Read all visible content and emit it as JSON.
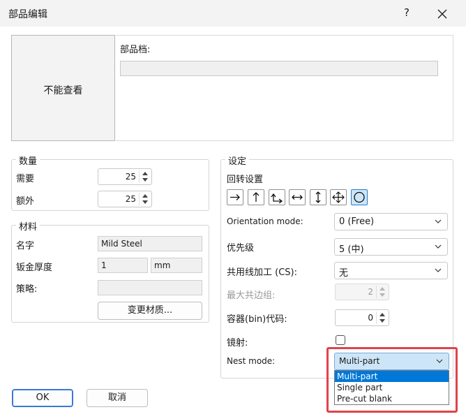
{
  "window": {
    "title": "部品编辑",
    "help": "?"
  },
  "preview": {
    "text": "不能查看"
  },
  "partfile": {
    "label": "部品档:",
    "value": ""
  },
  "quantity": {
    "legend": "数量",
    "required_label": "需要",
    "required_value": "25",
    "extra_label": "额外",
    "extra_value": "25"
  },
  "material": {
    "legend": "材料",
    "name_label": "名字",
    "name_value": "Mild Steel",
    "thickness_label": "钣金厚度",
    "thickness_value": "1",
    "thickness_unit": "mm",
    "strategy_label": "策略:",
    "strategy_value": "",
    "change_button": "变更材质..."
  },
  "settings": {
    "legend": "设定",
    "rotation_label": "回转设置",
    "rotation_icons": [
      "arrow-right-icon",
      "arrow-up-icon",
      "arrow-corner-icon",
      "arrow-left-right-icon",
      "arrow-up-down-icon",
      "move-cross-icon",
      "circle-free-icon"
    ],
    "orientation_label": "Orientation mode:",
    "orientation_value": "0 (Free)",
    "priority_label": "优先级",
    "priority_value": "5 (中)",
    "common_cut_label": "共用线加工 (CS):",
    "common_cut_value": "无",
    "max_common_label": "最大共边组:",
    "max_common_value": "2",
    "bin_code_label": "容器(bin)代码:",
    "bin_code_value": "0",
    "mirror_label": "镜射:",
    "nest_mode_label": "Nest mode:",
    "nest_mode_value": "Multi-part",
    "nest_mode_options": [
      "Multi-part",
      "Single part",
      "Pre-cut blank"
    ]
  },
  "buttons": {
    "ok": "OK",
    "cancel": "取消"
  },
  "colors": {
    "accent": "#0078d7",
    "highlight": "#e0434a",
    "selected_bg": "#cde6f7"
  }
}
